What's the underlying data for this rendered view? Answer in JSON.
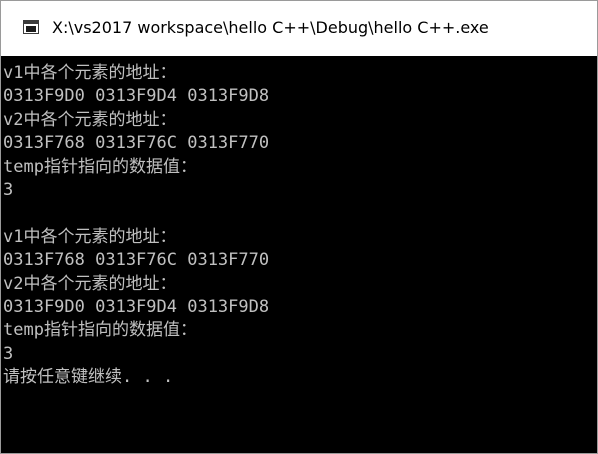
{
  "window": {
    "title": "X:\\vs2017 workspace\\hello C++\\Debug\\hello C++.exe",
    "icon": "console-app-icon"
  },
  "console": {
    "lines": [
      "v1中各个元素的地址：",
      "0313F9D0 0313F9D4 0313F9D8",
      "v2中各个元素的地址：",
      "0313F768 0313F76C 0313F770",
      "temp指针指向的数据值：",
      "3",
      "",
      "v1中各个元素的地址：",
      "0313F768 0313F76C 0313F770",
      "v2中各个元素的地址：",
      "0313F9D0 0313F9D4 0313F9D8",
      "temp指针指向的数据值：",
      "3",
      "请按任意键继续. . ."
    ],
    "colors": {
      "background": "#000000",
      "text": "#c0c0c0"
    }
  }
}
